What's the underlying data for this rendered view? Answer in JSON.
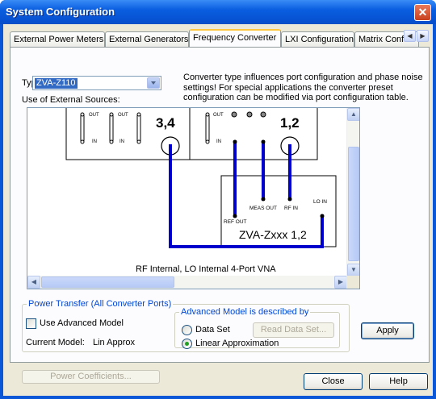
{
  "window": {
    "title": "System Configuration",
    "close_glyph": "✕"
  },
  "tabs": [
    {
      "label": "External Power Meters"
    },
    {
      "label": "External Generators"
    },
    {
      "label": "Frequency Converter"
    },
    {
      "label": "LXI Configuration"
    },
    {
      "label": "Matrix Conf"
    }
  ],
  "tab_scroll": {
    "left": "◀",
    "right": "▶"
  },
  "converter": {
    "type_label": "Type:",
    "type_value": "ZVA-Z110",
    "info_text": "Converter type influences port configuration and phase noise settings! For special applications the converter preset configuration can be modified via port configuration table.",
    "sources_label": "Use of External Sources:"
  },
  "diagram": {
    "port_left": "3,4",
    "port_right": "1,2",
    "out_label": "OUT",
    "in_label": "IN",
    "ref_out": "REF OUT",
    "meas_out": "MEAS OUT",
    "rf_in": "RF IN",
    "lo_in": "LO IN",
    "converter_name": "ZVA-Zxxx 1,2",
    "caption": "RF Internal, LO Internal 4-Port VNA",
    "wire_color": "#0000cc"
  },
  "power_transfer": {
    "title": "Power Transfer (All Converter Ports)",
    "use_advanced_label": "Use Advanced Model",
    "use_advanced_checked": false,
    "current_model_label": "Current Model:",
    "current_model_value": "Lin Approx",
    "advanced_title": "Advanced Model is described by",
    "data_set_label": "Data Set",
    "read_data_set_label": "Read Data Set...",
    "linear_label": "Linear Approximation",
    "selected": "Linear Approximation",
    "power_coeff_label": "Power Coefficients..."
  },
  "buttons": {
    "apply": "Apply",
    "close": "Close",
    "help": "Help"
  }
}
